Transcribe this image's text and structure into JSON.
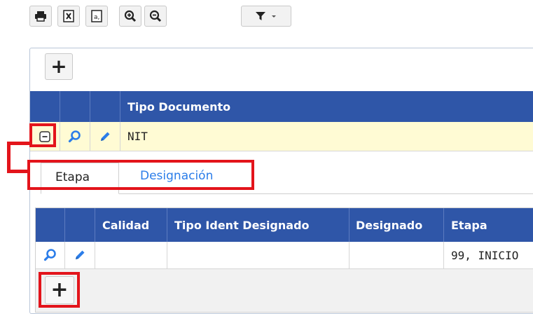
{
  "toolbar": {
    "buttons": [
      {
        "icon": "print-icon"
      },
      {
        "icon": "excel-export-icon"
      },
      {
        "icon": "text-export-icon"
      },
      {
        "icon": "zoom-in-icon"
      },
      {
        "icon": "zoom-out-icon"
      },
      {
        "icon": "filter-icon"
      }
    ]
  },
  "master": {
    "add_label": "+",
    "columns": [
      "Tipo Documento"
    ],
    "rows": [
      {
        "tipo_documento": "NIT"
      }
    ]
  },
  "tabs": [
    {
      "label": "Etapa",
      "active": true
    },
    {
      "label": "Designación",
      "active": false
    }
  ],
  "detail": {
    "columns": [
      "Calidad",
      "Tipo Ident Designado",
      "Designado",
      "Etapa"
    ],
    "rows": [
      {
        "calidad": "",
        "tipo_ident_designado": "",
        "designado": "",
        "etapa": "99, INICIO"
      }
    ],
    "add_label": "+"
  },
  "colors": {
    "header_bg": "#2f56a8",
    "selected_row_bg": "#fffbd4",
    "highlight_red": "#e3141b",
    "link_blue": "#2b7de9"
  }
}
